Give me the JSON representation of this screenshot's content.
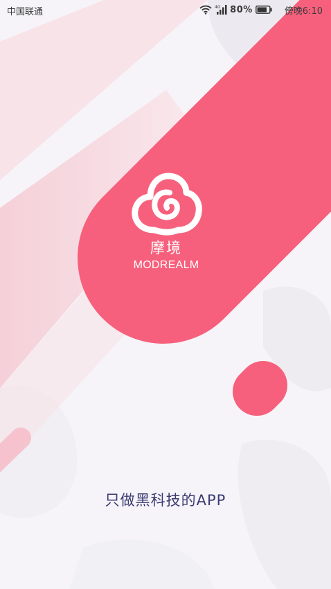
{
  "status_bar": {
    "carrier": "中国联通",
    "network": "4G",
    "battery_percent": "80%",
    "time": "傍晚6:10",
    "icons": [
      "wifi-icon",
      "signal-icon",
      "battery-icon"
    ]
  },
  "splash": {
    "app_name": "摩境",
    "app_name_latin": "MODREALM",
    "tagline": "只做黑科技的APP",
    "logo_icon": "swirl-cloud-logo-icon"
  },
  "colors": {
    "accent": "#f7607c",
    "accent_light": "#f6cdd6",
    "tagline": "#3b3a72",
    "background": "#f6f4f8"
  }
}
